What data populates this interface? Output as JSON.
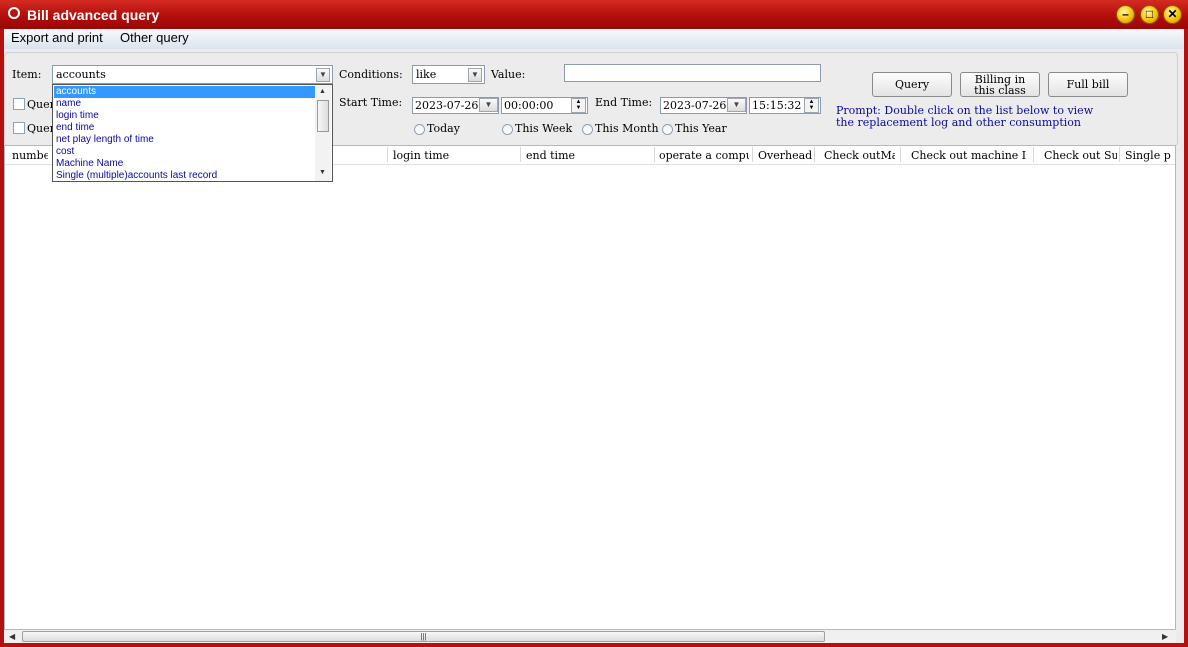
{
  "window": {
    "title": "Bill advanced query"
  },
  "menu": {
    "export_print": "Export and print",
    "other_query": "Other query"
  },
  "form": {
    "item_label": "Item:",
    "item_value": "accounts",
    "conditions_label": "Conditions:",
    "conditions_value": "like",
    "value_label": "Value:",
    "value_input": "",
    "query_checkbox_1": "Quer",
    "query_checkbox_2": "Quer",
    "start_time_label": "Start Time:",
    "start_date": "2023-07-26",
    "start_time": "00:00:00",
    "end_time_label": "End Time:",
    "end_date": "2023-07-26",
    "end_time": "15:15:32",
    "radio_today": "Today",
    "radio_week": "This Week",
    "radio_month": "This Month",
    "radio_year": "This Year"
  },
  "buttons": {
    "query": "Query",
    "billing_class_1": "Billing in",
    "billing_class_2": "this class",
    "full_bill": "Full bill"
  },
  "prompt": {
    "line1": "Prompt: Double click on the list below to view",
    "line2": "the replacement log and other consumption"
  },
  "dropdown": {
    "items": [
      "accounts",
      "name",
      "login time",
      "end time",
      "net play length of time",
      "cost",
      "Machine Name",
      "Single (multiple)accounts last record"
    ],
    "selected_index": 0
  },
  "grid": {
    "columns": [
      "number",
      "login time",
      "end time",
      "operate a compu",
      "Overhead",
      "Check outMa",
      "Check out machine I",
      "Check out Su",
      "Single p"
    ]
  },
  "icons": {
    "up": "▲",
    "down": "▼",
    "scroll_left": "◀",
    "scroll_right": "▶",
    "grip": "|||"
  }
}
